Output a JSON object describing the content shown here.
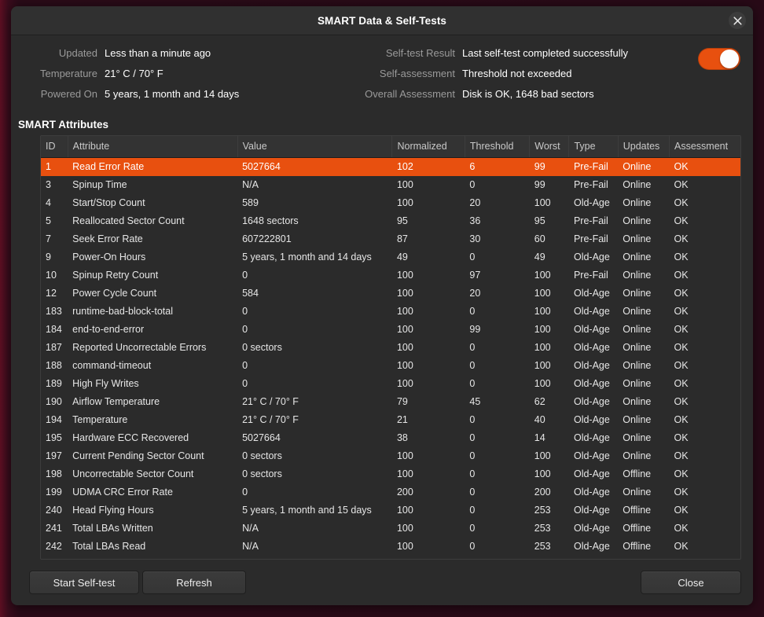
{
  "window": {
    "title": "SMART Data & Self-Tests",
    "close_icon": "close-icon"
  },
  "info": {
    "left": [
      {
        "label": "Updated",
        "value": "Less than a minute ago"
      },
      {
        "label": "Temperature",
        "value": "21° C / 70° F"
      },
      {
        "label": "Powered On",
        "value": "5 years, 1 month and 14 days"
      }
    ],
    "right": [
      {
        "label": "Self-test Result",
        "value": "Last self-test completed successfully"
      },
      {
        "label": "Self-assessment",
        "value": "Threshold not exceeded"
      },
      {
        "label": "Overall Assessment",
        "value": "Disk is OK, 1648 bad sectors"
      }
    ],
    "toggle": {
      "name": "smart-enabled-toggle",
      "state": "on",
      "color": "#e8500f"
    }
  },
  "attributes_section": {
    "heading": "SMART Attributes",
    "columns": [
      "ID",
      "Attribute",
      "Value",
      "Normalized",
      "Threshold",
      "Worst",
      "Type",
      "Updates",
      "Assessment"
    ],
    "selected_row_index": 0,
    "selected_row_color": "#e8500f",
    "rows": [
      {
        "id": "1",
        "attribute": "Read Error Rate",
        "value": "5027664",
        "normalized": "102",
        "threshold": "6",
        "worst": "99",
        "type": "Pre-Fail",
        "updates": "Online",
        "assessment": "OK"
      },
      {
        "id": "3",
        "attribute": "Spinup Time",
        "value": "N/A",
        "normalized": "100",
        "threshold": "0",
        "worst": "99",
        "type": "Pre-Fail",
        "updates": "Online",
        "assessment": "OK"
      },
      {
        "id": "4",
        "attribute": "Start/Stop Count",
        "value": "589",
        "normalized": "100",
        "threshold": "20",
        "worst": "100",
        "type": "Old-Age",
        "updates": "Online",
        "assessment": "OK"
      },
      {
        "id": "5",
        "attribute": "Reallocated Sector Count",
        "value": "1648 sectors",
        "normalized": "95",
        "threshold": "36",
        "worst": "95",
        "type": "Pre-Fail",
        "updates": "Online",
        "assessment": "OK"
      },
      {
        "id": "7",
        "attribute": "Seek Error Rate",
        "value": "607222801",
        "normalized": "87",
        "threshold": "30",
        "worst": "60",
        "type": "Pre-Fail",
        "updates": "Online",
        "assessment": "OK"
      },
      {
        "id": "9",
        "attribute": "Power-On Hours",
        "value": "5 years, 1 month and 14 days",
        "normalized": "49",
        "threshold": "0",
        "worst": "49",
        "type": "Old-Age",
        "updates": "Online",
        "assessment": "OK"
      },
      {
        "id": "10",
        "attribute": "Spinup Retry Count",
        "value": "0",
        "normalized": "100",
        "threshold": "97",
        "worst": "100",
        "type": "Pre-Fail",
        "updates": "Online",
        "assessment": "OK"
      },
      {
        "id": "12",
        "attribute": "Power Cycle Count",
        "value": "584",
        "normalized": "100",
        "threshold": "20",
        "worst": "100",
        "type": "Old-Age",
        "updates": "Online",
        "assessment": "OK"
      },
      {
        "id": "183",
        "attribute": "runtime-bad-block-total",
        "value": "0",
        "normalized": "100",
        "threshold": "0",
        "worst": "100",
        "type": "Old-Age",
        "updates": "Online",
        "assessment": "OK"
      },
      {
        "id": "184",
        "attribute": "end-to-end-error",
        "value": "0",
        "normalized": "100",
        "threshold": "99",
        "worst": "100",
        "type": "Old-Age",
        "updates": "Online",
        "assessment": "OK"
      },
      {
        "id": "187",
        "attribute": "Reported Uncorrectable Errors",
        "value": "0 sectors",
        "normalized": "100",
        "threshold": "0",
        "worst": "100",
        "type": "Old-Age",
        "updates": "Online",
        "assessment": "OK"
      },
      {
        "id": "188",
        "attribute": "command-timeout",
        "value": "0",
        "normalized": "100",
        "threshold": "0",
        "worst": "100",
        "type": "Old-Age",
        "updates": "Online",
        "assessment": "OK"
      },
      {
        "id": "189",
        "attribute": "High Fly Writes",
        "value": "0",
        "normalized": "100",
        "threshold": "0",
        "worst": "100",
        "type": "Old-Age",
        "updates": "Online",
        "assessment": "OK"
      },
      {
        "id": "190",
        "attribute": "Airflow Temperature",
        "value": "21° C / 70° F",
        "normalized": "79",
        "threshold": "45",
        "worst": "62",
        "type": "Old-Age",
        "updates": "Online",
        "assessment": "OK"
      },
      {
        "id": "194",
        "attribute": "Temperature",
        "value": "21° C / 70° F",
        "normalized": "21",
        "threshold": "0",
        "worst": "40",
        "type": "Old-Age",
        "updates": "Online",
        "assessment": "OK"
      },
      {
        "id": "195",
        "attribute": "Hardware ECC Recovered",
        "value": "5027664",
        "normalized": "38",
        "threshold": "0",
        "worst": "14",
        "type": "Old-Age",
        "updates": "Online",
        "assessment": "OK"
      },
      {
        "id": "197",
        "attribute": "Current Pending Sector Count",
        "value": "0 sectors",
        "normalized": "100",
        "threshold": "0",
        "worst": "100",
        "type": "Old-Age",
        "updates": "Online",
        "assessment": "OK"
      },
      {
        "id": "198",
        "attribute": "Uncorrectable Sector Count",
        "value": "0 sectors",
        "normalized": "100",
        "threshold": "0",
        "worst": "100",
        "type": "Old-Age",
        "updates": "Offline",
        "assessment": "OK"
      },
      {
        "id": "199",
        "attribute": "UDMA CRC Error Rate",
        "value": "0",
        "normalized": "200",
        "threshold": "0",
        "worst": "200",
        "type": "Old-Age",
        "updates": "Online",
        "assessment": "OK"
      },
      {
        "id": "240",
        "attribute": "Head Flying Hours",
        "value": "5 years, 1 month and 15 days",
        "normalized": "100",
        "threshold": "0",
        "worst": "253",
        "type": "Old-Age",
        "updates": "Offline",
        "assessment": "OK"
      },
      {
        "id": "241",
        "attribute": "Total LBAs Written",
        "value": "N/A",
        "normalized": "100",
        "threshold": "0",
        "worst": "253",
        "type": "Old-Age",
        "updates": "Offline",
        "assessment": "OK"
      },
      {
        "id": "242",
        "attribute": "Total LBAs Read",
        "value": "N/A",
        "normalized": "100",
        "threshold": "0",
        "worst": "253",
        "type": "Old-Age",
        "updates": "Offline",
        "assessment": "OK"
      }
    ]
  },
  "footer": {
    "start_self_test_label": "Start Self-test",
    "refresh_label": "Refresh",
    "close_label": "Close"
  }
}
